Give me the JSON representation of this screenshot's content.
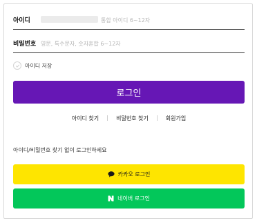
{
  "login_form": {
    "id_field": {
      "label": "아이디",
      "placeholder": "통합 아이디 6~12자"
    },
    "password_field": {
      "label": "비밀번호",
      "placeholder": "영문, 특수문자, 숫자혼합 6~12자"
    },
    "save_id": {
      "label": "아이디 저장",
      "checked": false
    },
    "login_button": "로그인",
    "links": {
      "find_id": "아이디 찾기",
      "find_password": "비밀번호 찾기",
      "signup": "회원가입"
    },
    "social_hint": "아이디/비밀번호 찾기 없이 로그인하세요",
    "kakao_button": {
      "label": "카카오 로그인",
      "icon": "speech-bubble-icon",
      "color": "#fee500"
    },
    "naver_button": {
      "label": "네이버 로그인",
      "icon": "naver-n-icon",
      "color": "#03c75a"
    },
    "accent_color": "#6617b5"
  }
}
